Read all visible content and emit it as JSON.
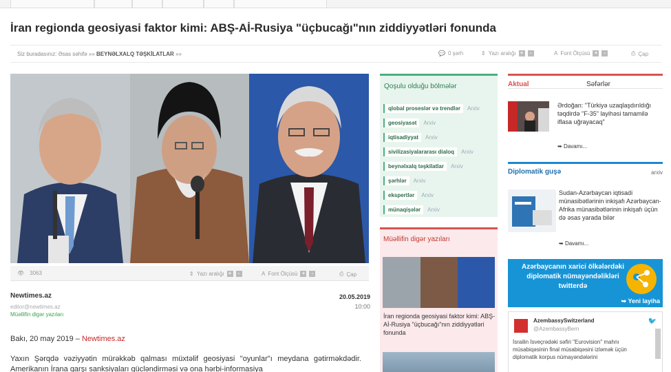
{
  "article": {
    "title": "İran regionda geosiyasi faktor kimi: ABŞ-Aİ-Rusiya \"üçbucağı\"nın ziddiyyətləri fonunda"
  },
  "breadcrumb": {
    "prefix": "Siz buradasınız:",
    "home": "Əsas səhifə",
    "sep": "»»",
    "section": "BEYNƏLXALQ TƏŞKİLATLAR",
    "trail": "»»"
  },
  "toolbar": {
    "comments": "0 şərh",
    "font_size": "Yazı aralığı",
    "font_label": "Font Ölçüsü",
    "print": "Çap",
    "plus": "+",
    "minus": "-"
  },
  "photo_bar": {
    "views": "3063",
    "font_size": "Yazı aralığı",
    "font_label": "Font Ölçüsü",
    "print": "Çap"
  },
  "meta": {
    "source": "Newtimes.az",
    "email": "editor@newtimes.az",
    "author_link": "Müəllifin digər yazıları",
    "date": "20.05.2019",
    "time": "10:00"
  },
  "body": {
    "dateline_prefix": "Bakı, 20 may 2019 –",
    "dateline_site": "Newtimes.az",
    "lead": "Yaxın Şərqdə vəziyyətin mürəkkəb qalması müxtəlif geosiyasi \"oyunlar\"ı meydana gətirməkdədir. Amerikanın İrana qarşı sanksiyaları gücləndirməsi və ona hərbi-informasiya"
  },
  "sections_box": {
    "title": "Qoşulu olduğu bölmələr",
    "archive_label": "Arxiv",
    "items": [
      "qlobal proseslər və trendlər",
      "geosiyasət",
      "iqtisadiyyat",
      "sivilizasiyalararası dialoq",
      "beynəlxalq təşkilatlar",
      "şərhlər",
      "ekspertlər",
      "münaqişələr"
    ]
  },
  "other_box": {
    "title": "Müəllifin digər yazıları",
    "article_title": "İran regionda geosiyasi faktor kimi: ABŞ-Aİ-Rusiya \"üçbucağı\"nın ziddiyyətləri fonunda"
  },
  "right": {
    "tab_active": "Aktual",
    "tab_other": "Səfərlər",
    "news1": "Ərdoğan: \"Türkiyə uzaqlaşdırıldığı təqdirdə \"F-35\" layihəsi tamamilə iflasa uğrayacaq\"",
    "more": "Davamı...",
    "diplomatic_title": "Diplomatik guşə",
    "diplomatic_right": "arxiv",
    "news2": "Sudan-Azərbaycan iqtisadi münasibətlərinin inkişafı Azərbaycan-Afrika münasibətlərinin inkişafı üçün də əsas yarada bilər",
    "banner_text": "Azərbaycanın xarici ölkələrdəki diplomatik nümayəndəlikləri twitterdə",
    "banner_link": "Yeni layiha",
    "tweet_name": "AzembassySwitzerland",
    "tweet_handle": "@AzembassyBern",
    "tweet_text": "İsrailin İsveçrədəki səfiri \"Eurovision\" mahnı müsabiqəsinin final müsabiqəsini izləmək üçün diplomatik korpus nümayəndələrini"
  }
}
